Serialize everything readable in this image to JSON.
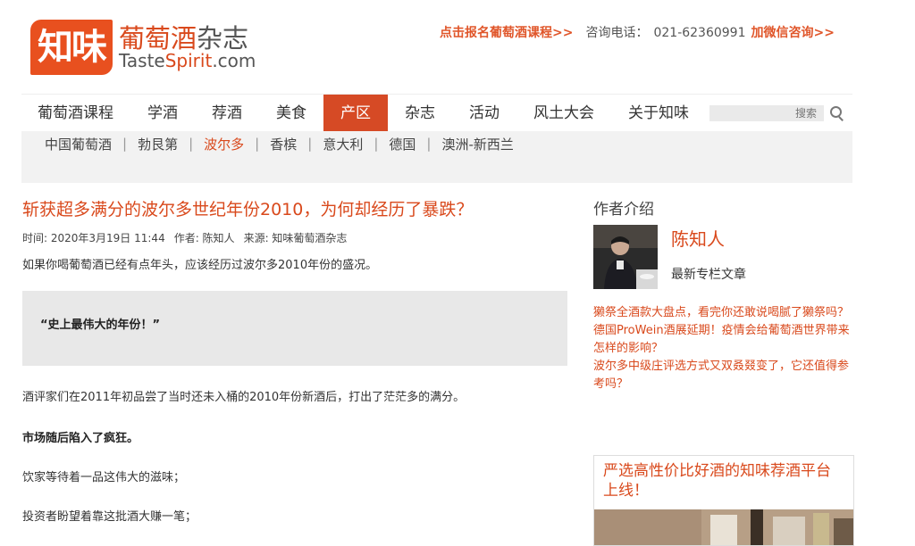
{
  "logo": {
    "mark": "知味",
    "cn_orange": "葡萄酒",
    "cn_gray": "杂志",
    "en_a": "Taste",
    "en_b": "Spirit",
    "en_c": ".com"
  },
  "top_links": {
    "enroll": "点击报名葡萄酒课程>>",
    "phone_label": "咨询电话：",
    "phone": "021-62360991",
    "wechat": "加微信咨询>>"
  },
  "nav": {
    "items": [
      "葡萄酒课程",
      "学酒",
      "荐酒",
      "美食",
      "产区",
      "杂志",
      "活动",
      "风土大会",
      "关于知味"
    ],
    "active_index": 4,
    "search_placeholder": "搜索"
  },
  "subnav": {
    "items": [
      "中国葡萄酒",
      "勃艮第",
      "波尔多",
      "香槟",
      "意大利",
      "德国",
      "澳洲-新西兰"
    ],
    "active_index": 2
  },
  "article": {
    "title": "斩获超多满分的波尔多世纪年份2010，为何却经历了暴跌？",
    "time": "时间: 2020年3月19日 11:44",
    "author": "作者: 陈知人",
    "source": "来源: 知味葡萄酒杂志",
    "intro": "如果你喝葡萄酒已经有点年头，应该经历过波尔多2010年份的盛况。",
    "quote": "“史上最伟大的年份！”",
    "p1": "酒评家们在2011年初品尝了当时还未入桶的2010年份新酒后，打出了茫茫多的满分。",
    "p2": "市场随后陷入了疯狂。",
    "p3": "饮家等待着一品这伟大的滋味；",
    "p4": "投资者盼望着靠这批酒大赚一笔；"
  },
  "sidebar": {
    "title": "作者介绍",
    "author_name": "陈知人",
    "latest_label": "最新专栏文章",
    "links": [
      "獭祭全酒款大盘点，看完你还敢说喝腻了獭祭吗？",
      "德国ProWein酒展延期！疫情会给葡萄酒世界带来怎样的影响？",
      "波尔多中级庄评选方式又双叒叕变了，它还值得参考吗？"
    ],
    "promo_title": "严选高性价比好酒的知味荐酒平台上线！"
  }
}
